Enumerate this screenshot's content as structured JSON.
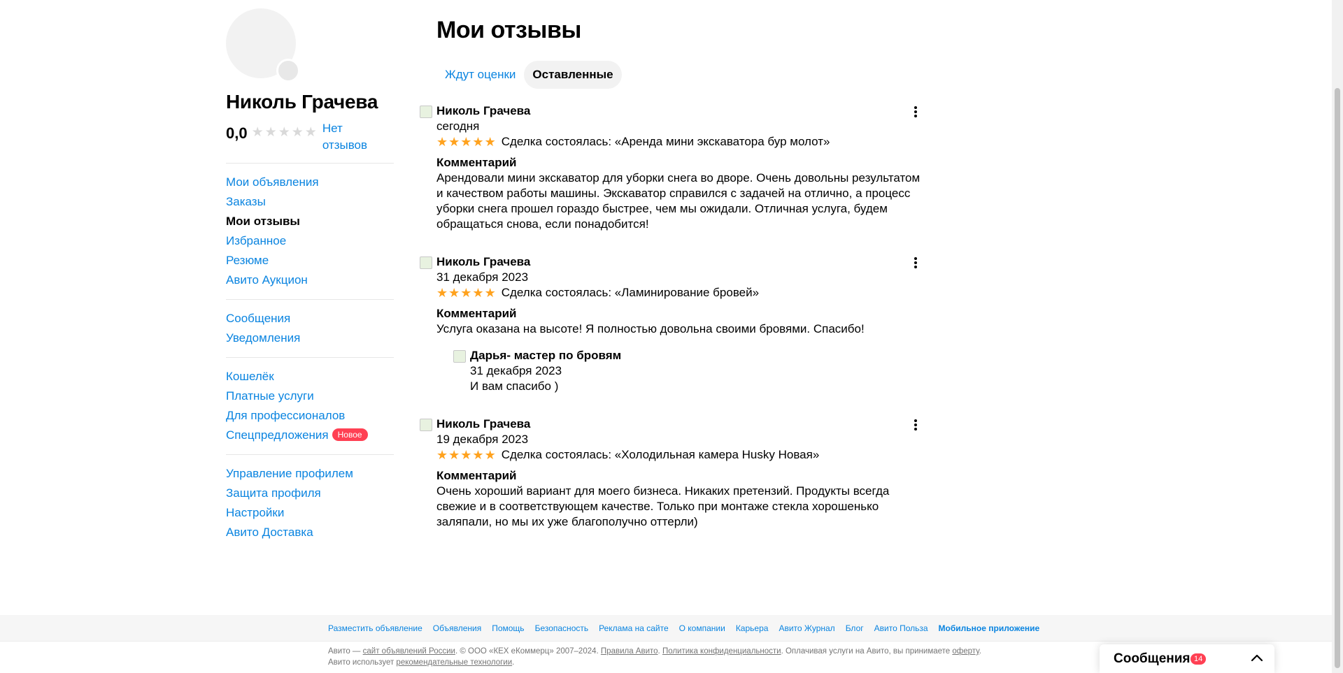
{
  "profile": {
    "name": "Николь Грачева",
    "rating": "0,0",
    "no_reviews": "Нет отзывов"
  },
  "nav": {
    "group1": [
      "Мои объявления",
      "Заказы",
      "Мои отзывы",
      "Избранное",
      "Резюме",
      "Авито Аукцион"
    ],
    "group2": [
      "Сообщения",
      "Уведомления"
    ],
    "group3": [
      "Кошелёк",
      "Платные услуги",
      "Для профессионалов",
      "Спецпредложения"
    ],
    "group3_badge": "Новое",
    "group4": [
      "Управление профилем",
      "Защита профиля",
      "Настройки",
      "Авито Доставка"
    ],
    "active": "Мои отзывы"
  },
  "page": {
    "title": "Мои отзывы",
    "tabs": [
      "Ждут оценки",
      "Оставленные"
    ],
    "active_tab": "Оставленные"
  },
  "reviews": [
    {
      "author": "Николь Грачева",
      "date": "сегодня",
      "stars": 5,
      "deal": "Сделка состоялась: «Аренда мини экскаватора бур молот»",
      "comment_title": "Комментарий",
      "comment": "Арендовали мини экскаватор для уборки снега во дворе. Очень довольны результатом и качеством работы машины. Экскаватор справился с задачей на отлично, а процесс уборки снега прошел гораздо быстрее, чем мы ожидали. Отличная услуга, будем обращаться снова, если понадобится!"
    },
    {
      "author": "Николь Грачева",
      "date": "31 декабря 2023",
      "stars": 5,
      "deal": "Сделка состоялась: «Ламинирование бровей»",
      "comment_title": "Комментарий",
      "comment": "Услуга оказана на высоте! Я полностью довольна своими бровями. Спасибо!",
      "reply": {
        "author": "Дарья- мастер по бровям",
        "date": "31 декабря 2023",
        "text": "И вам спасибо )"
      }
    },
    {
      "author": "Николь Грачева",
      "date": "19 декабря 2023",
      "stars": 5,
      "deal": "Сделка состоялась: «Холодильная камера Husky Новая»",
      "comment_title": "Комментарий",
      "comment": "Очень хороший вариант для моего бизнеса. Никаких претензий. Продукты всегда свежие и в соответствующем качестве. Только при монтаже стекла хорошенько заляпали, но мы их уже благополучно оттерли)"
    }
  ],
  "footer": {
    "links": [
      "Разместить объявление",
      "Объявления",
      "Помощь",
      "Безопасность",
      "Реклама на сайте",
      "О компании",
      "Карьера",
      "Авито Журнал",
      "Блог",
      "Авито Польза",
      "Мобильное приложение"
    ],
    "legal_1": "Авито — ",
    "legal_link_1": "сайт объявлений России",
    "legal_2": ". © ООО «КЕХ еКоммерц» 2007–2024. ",
    "legal_link_2": "Правила Авито",
    "legal_3": ". ",
    "legal_link_3": "Политика конфиденциальности",
    "legal_4": ". Оплачивая услуги на Авито, вы принимаете ",
    "legal_link_4": "оферту",
    "legal_5": ". Авито использует ",
    "legal_link_5": "рекомендательные технологии",
    "legal_6": "."
  },
  "messages_panel": {
    "title": "Сообщения",
    "count": "14"
  },
  "colors": {
    "link": "#0a84e0",
    "star": "#ffa21e",
    "badge": "#ff4053"
  }
}
